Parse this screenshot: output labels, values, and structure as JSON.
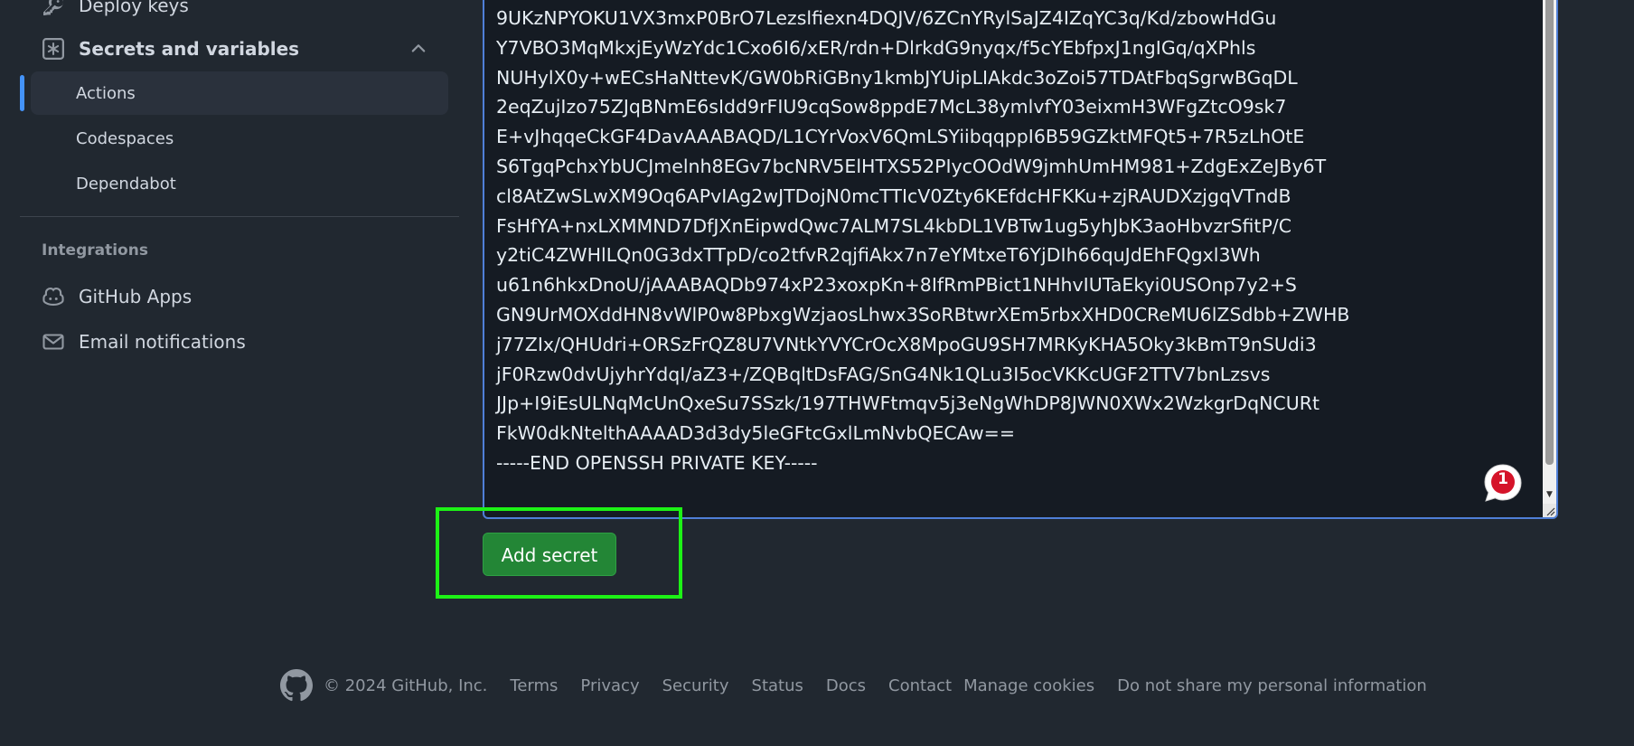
{
  "sidebar": {
    "deploy_keys": "Deploy keys",
    "secrets_section": "Secrets and variables",
    "sub_items": [
      "Actions",
      "Codespaces",
      "Dependabot"
    ],
    "integrations_heading": "Integrations",
    "github_apps": "GitHub Apps",
    "email_notifications": "Email notifications"
  },
  "textarea": {
    "lines": [
      "9UKzNPYOKU1VX3mxP0BrO7Lezslfiexn4DQJV/6ZCnYRylSaJZ4IZqYC3q/Kd/zbowHdGu",
      "Y7VBO3MqMkxjEyWzYdc1Cxo6I6/xER/rdn+DlrkdG9nyqx/f5cYEbfpxJ1ngIGq/qXPhls",
      "NUHylX0y+wECsHaNttevK/GW0bRiGBny1kmbJYUipLIAkdc3oZoi57TDAtFbqSgrwBGqDL",
      "2eqZujIzo75ZJqBNmE6sIdd9rFIU9cqSow8ppdE7McL38ymlvfY03eixmH3WFgZtcO9sk7",
      "E+vJhqqeCkGF4DavAAABAQD/L1CYrVoxV6QmLSYiibqqppI6B59GZktMFQt5+7R5zLhOtE",
      "S6TgqPchxYbUCJmelnh8EGv7bcNRV5ElHTXS52PIycOOdW9jmhUmHM981+ZdgExZeJBy6T",
      "cl8AtZwSLwXM9Oq6APvIAg2wJTDojN0mcTTIcV0Zty6KEfdcHFKKu+zjRAUDXzjgqVTndB",
      "FsHfYA+nxLXMMND7DfJXnEipwdQwc7ALM7SL4kbDL1VBTw1ug5yhJbK3aoHbvzrSfitP/C",
      "y2tiC4ZWHlLQn0G3dxTTpD/co2tfvR2qjfiAkx7n7eYMtxeT6YjDIh66quJdEhFQgxl3Wh",
      "u61n6hkxDnoU/jAAABAQDb974xP23xoxpKn+8IfRmPBict1NHhvIUTaEkyi0USOnp7y2+S",
      "GN9UrMOXddHN8vWlP0w8PbxgWzjaosLhwx3SoRBtwrXEm5rbxXHD0CReMU6lZSdbb+ZWHB",
      "j77ZIx/QHUdri+ORSzFrQZ8U7VNtkYVYCrOcX8MpoGU9SH7MRKyKHA5Oky3kBmT9nSUdi3",
      "jF0Rzw0dvUjyhrYdqI/aZ3+/ZQBqltDsFAG/SnG4Nk1QLu3I5ocVKKcUGF2TTV7bnLzsvs",
      "JJp+I9iEsULNqMcUnQxeSu7SSzk/197THWFtmqv5j3eNgWhDP8JWN0XWx2WzkgrDqNCURt",
      "FkW0dkNtelthAAAAD3d3dy5leGFtcGxlLmNvbQECAw==",
      "-----END OPENSSH PRIVATE KEY-----"
    ]
  },
  "notification": {
    "count": "1"
  },
  "actions": {
    "add_secret": "Add secret"
  },
  "footer": {
    "copyright": "© 2024 GitHub, Inc.",
    "links": [
      "Terms",
      "Privacy",
      "Security",
      "Status",
      "Docs",
      "Contact",
      "Manage cookies",
      "Do not share my personal information"
    ]
  },
  "colors": {
    "background": "#212830",
    "button_green": "#238636",
    "highlight": "#1df216",
    "accent_blue": "#4493f8"
  },
  "icons": {
    "deploy_keys": "key-icon",
    "secrets": "asterisk-box-icon",
    "collapse": "chevron-up-icon",
    "github_apps": "copilot-icon",
    "email": "mail-icon",
    "footer_logo": "github-logo-icon"
  }
}
